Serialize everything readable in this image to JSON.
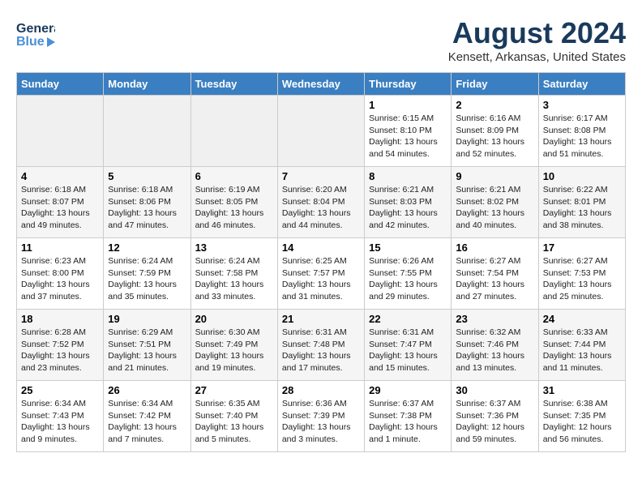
{
  "header": {
    "logo_line1": "General",
    "logo_line2": "Blue",
    "title": "August 2024",
    "subtitle": "Kensett, Arkansas, United States"
  },
  "weekdays": [
    "Sunday",
    "Monday",
    "Tuesday",
    "Wednesday",
    "Thursday",
    "Friday",
    "Saturday"
  ],
  "weeks": [
    [
      {
        "day": "",
        "info": ""
      },
      {
        "day": "",
        "info": ""
      },
      {
        "day": "",
        "info": ""
      },
      {
        "day": "",
        "info": ""
      },
      {
        "day": "1",
        "info": "Sunrise: 6:15 AM\nSunset: 8:10 PM\nDaylight: 13 hours\nand 54 minutes."
      },
      {
        "day": "2",
        "info": "Sunrise: 6:16 AM\nSunset: 8:09 PM\nDaylight: 13 hours\nand 52 minutes."
      },
      {
        "day": "3",
        "info": "Sunrise: 6:17 AM\nSunset: 8:08 PM\nDaylight: 13 hours\nand 51 minutes."
      }
    ],
    [
      {
        "day": "4",
        "info": "Sunrise: 6:18 AM\nSunset: 8:07 PM\nDaylight: 13 hours\nand 49 minutes."
      },
      {
        "day": "5",
        "info": "Sunrise: 6:18 AM\nSunset: 8:06 PM\nDaylight: 13 hours\nand 47 minutes."
      },
      {
        "day": "6",
        "info": "Sunrise: 6:19 AM\nSunset: 8:05 PM\nDaylight: 13 hours\nand 46 minutes."
      },
      {
        "day": "7",
        "info": "Sunrise: 6:20 AM\nSunset: 8:04 PM\nDaylight: 13 hours\nand 44 minutes."
      },
      {
        "day": "8",
        "info": "Sunrise: 6:21 AM\nSunset: 8:03 PM\nDaylight: 13 hours\nand 42 minutes."
      },
      {
        "day": "9",
        "info": "Sunrise: 6:21 AM\nSunset: 8:02 PM\nDaylight: 13 hours\nand 40 minutes."
      },
      {
        "day": "10",
        "info": "Sunrise: 6:22 AM\nSunset: 8:01 PM\nDaylight: 13 hours\nand 38 minutes."
      }
    ],
    [
      {
        "day": "11",
        "info": "Sunrise: 6:23 AM\nSunset: 8:00 PM\nDaylight: 13 hours\nand 37 minutes."
      },
      {
        "day": "12",
        "info": "Sunrise: 6:24 AM\nSunset: 7:59 PM\nDaylight: 13 hours\nand 35 minutes."
      },
      {
        "day": "13",
        "info": "Sunrise: 6:24 AM\nSunset: 7:58 PM\nDaylight: 13 hours\nand 33 minutes."
      },
      {
        "day": "14",
        "info": "Sunrise: 6:25 AM\nSunset: 7:57 PM\nDaylight: 13 hours\nand 31 minutes."
      },
      {
        "day": "15",
        "info": "Sunrise: 6:26 AM\nSunset: 7:55 PM\nDaylight: 13 hours\nand 29 minutes."
      },
      {
        "day": "16",
        "info": "Sunrise: 6:27 AM\nSunset: 7:54 PM\nDaylight: 13 hours\nand 27 minutes."
      },
      {
        "day": "17",
        "info": "Sunrise: 6:27 AM\nSunset: 7:53 PM\nDaylight: 13 hours\nand 25 minutes."
      }
    ],
    [
      {
        "day": "18",
        "info": "Sunrise: 6:28 AM\nSunset: 7:52 PM\nDaylight: 13 hours\nand 23 minutes."
      },
      {
        "day": "19",
        "info": "Sunrise: 6:29 AM\nSunset: 7:51 PM\nDaylight: 13 hours\nand 21 minutes."
      },
      {
        "day": "20",
        "info": "Sunrise: 6:30 AM\nSunset: 7:49 PM\nDaylight: 13 hours\nand 19 minutes."
      },
      {
        "day": "21",
        "info": "Sunrise: 6:31 AM\nSunset: 7:48 PM\nDaylight: 13 hours\nand 17 minutes."
      },
      {
        "day": "22",
        "info": "Sunrise: 6:31 AM\nSunset: 7:47 PM\nDaylight: 13 hours\nand 15 minutes."
      },
      {
        "day": "23",
        "info": "Sunrise: 6:32 AM\nSunset: 7:46 PM\nDaylight: 13 hours\nand 13 minutes."
      },
      {
        "day": "24",
        "info": "Sunrise: 6:33 AM\nSunset: 7:44 PM\nDaylight: 13 hours\nand 11 minutes."
      }
    ],
    [
      {
        "day": "25",
        "info": "Sunrise: 6:34 AM\nSunset: 7:43 PM\nDaylight: 13 hours\nand 9 minutes."
      },
      {
        "day": "26",
        "info": "Sunrise: 6:34 AM\nSunset: 7:42 PM\nDaylight: 13 hours\nand 7 minutes."
      },
      {
        "day": "27",
        "info": "Sunrise: 6:35 AM\nSunset: 7:40 PM\nDaylight: 13 hours\nand 5 minutes."
      },
      {
        "day": "28",
        "info": "Sunrise: 6:36 AM\nSunset: 7:39 PM\nDaylight: 13 hours\nand 3 minutes."
      },
      {
        "day": "29",
        "info": "Sunrise: 6:37 AM\nSunset: 7:38 PM\nDaylight: 13 hours\nand 1 minute."
      },
      {
        "day": "30",
        "info": "Sunrise: 6:37 AM\nSunset: 7:36 PM\nDaylight: 12 hours\nand 59 minutes."
      },
      {
        "day": "31",
        "info": "Sunrise: 6:38 AM\nSunset: 7:35 PM\nDaylight: 12 hours\nand 56 minutes."
      }
    ]
  ]
}
